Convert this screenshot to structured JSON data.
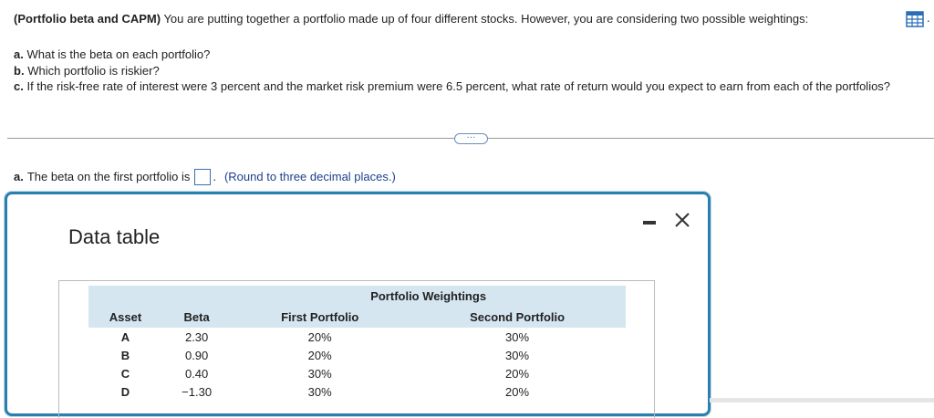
{
  "question": {
    "heading": "(Portfolio beta and CAPM)",
    "intro": "You are putting together a portfolio made up of four different stocks. However, you are considering two possible weightings:",
    "trailing": ".",
    "parts": [
      {
        "label": "a.",
        "text": "What is the beta on each portfolio?"
      },
      {
        "label": "b.",
        "text": "Which portfolio is riskier?"
      },
      {
        "label": "c.",
        "text": "If the risk-free rate of interest were 3 percent and the market risk premium were 6.5 percent, what rate of return would you expect to earn from each of the portfolios?"
      }
    ]
  },
  "expander": {
    "label": "···"
  },
  "answer": {
    "label": "a.",
    "text": "The beta on the first portfolio is",
    "input_value": "",
    "after": ".",
    "hint": "(Round to three decimal places.)"
  },
  "modal": {
    "title": "Data table",
    "table": {
      "group_header": "Portfolio Weightings",
      "columns": [
        "Asset",
        "Beta",
        "First Portfolio",
        "Second Portfolio"
      ],
      "rows": [
        [
          "A",
          "2.30",
          "20%",
          "30%"
        ],
        [
          "B",
          "0.90",
          "20%",
          "30%"
        ],
        [
          "C",
          "0.40",
          "30%",
          "20%"
        ],
        [
          "D",
          "−1.30",
          "30%",
          "20%"
        ]
      ]
    }
  },
  "icons": {
    "data_table": "grid-table-icon",
    "minimize": "minimize-icon",
    "close": "close-icon"
  },
  "colors": {
    "accent": "#2b7fae",
    "header_fill": "#d5e6f1",
    "hint_text": "#1d3f8f"
  }
}
